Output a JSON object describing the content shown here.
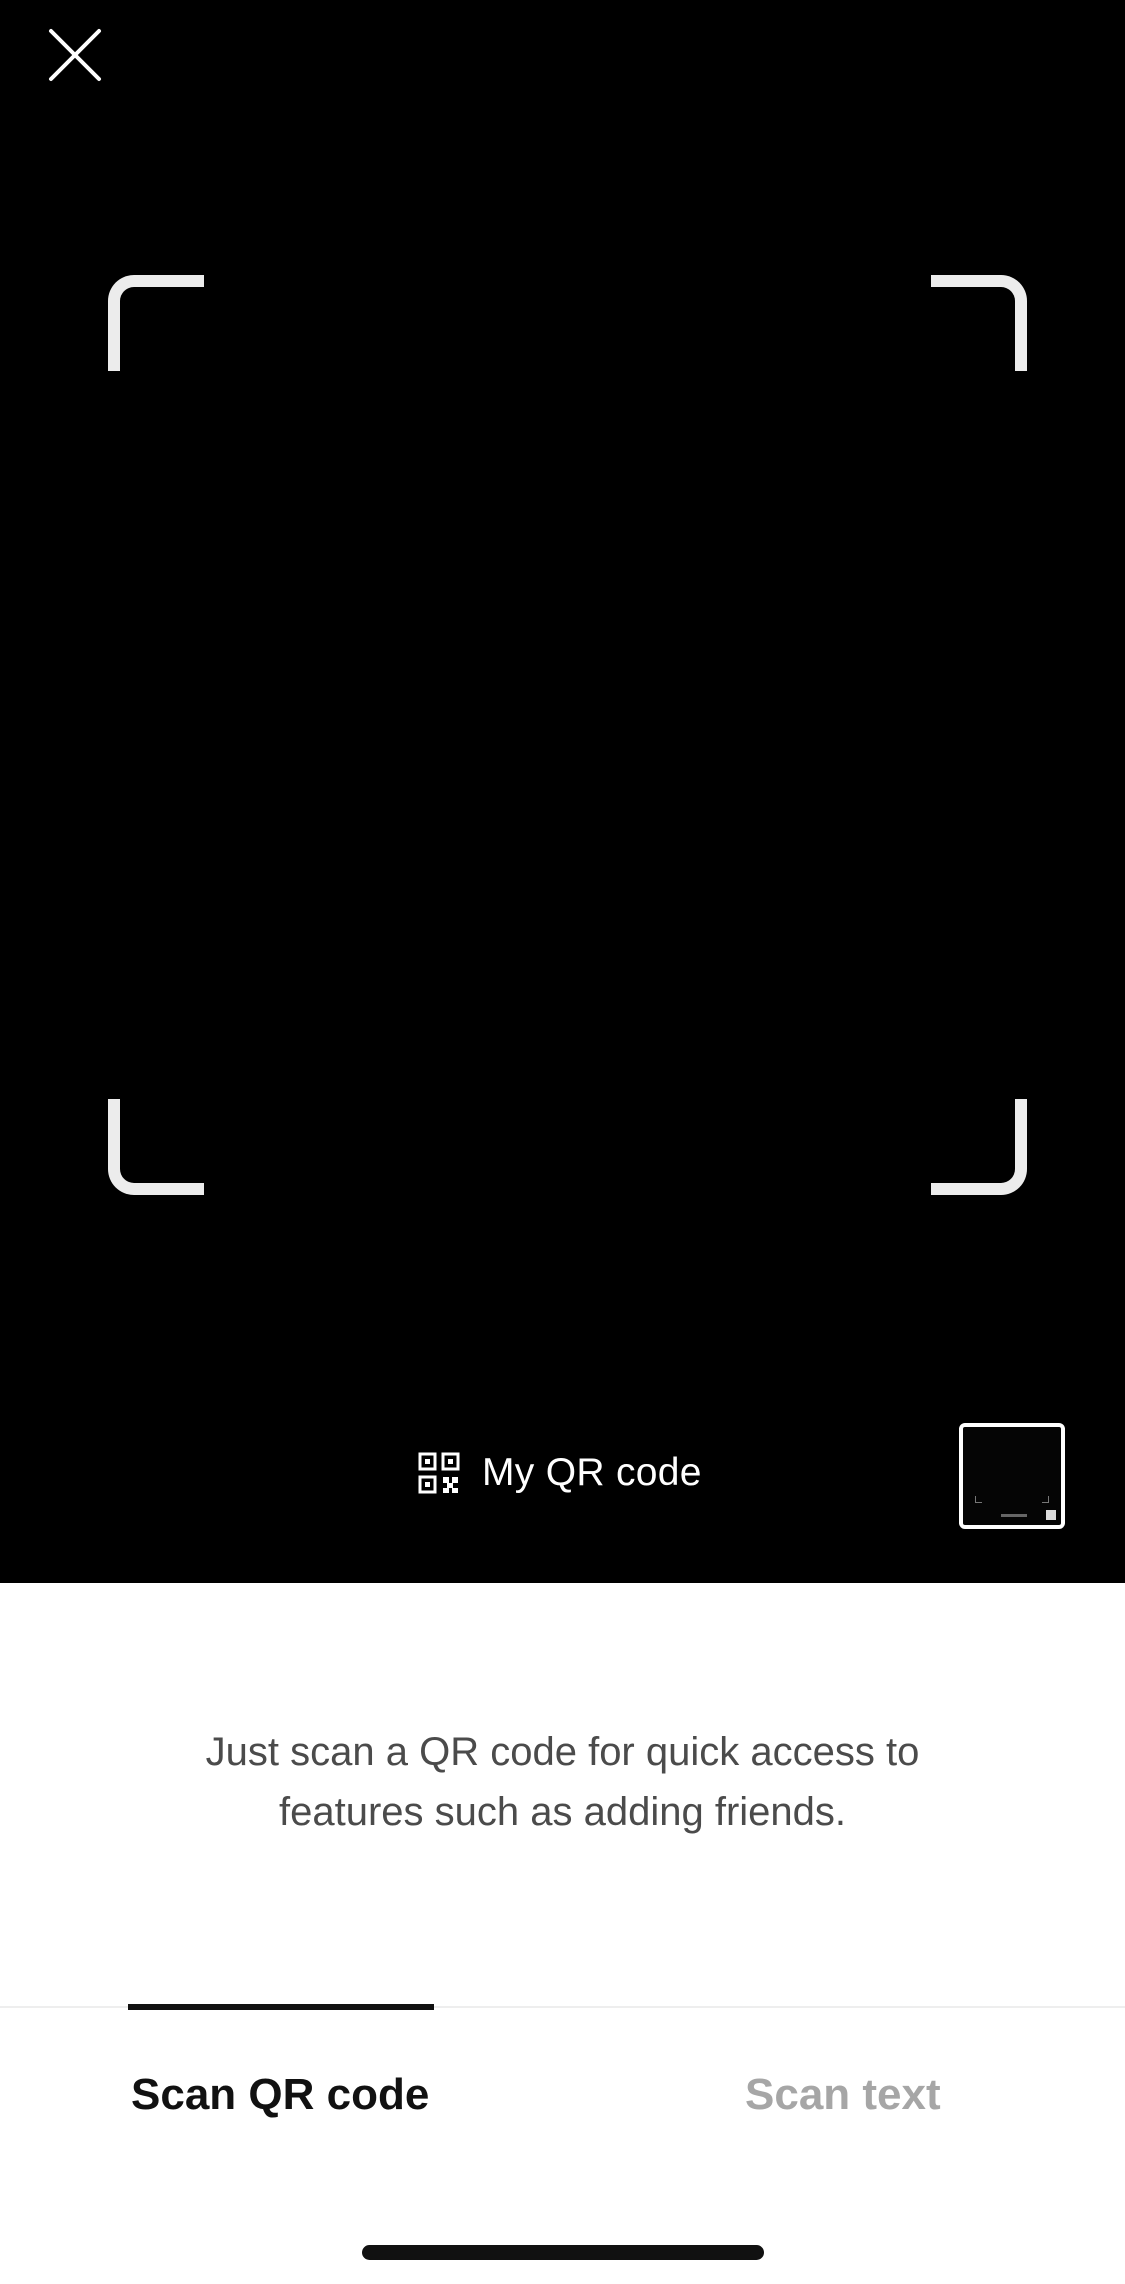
{
  "camera": {
    "close_icon": "close-icon",
    "my_qr_icon": "qr-code-icon",
    "my_qr_label": "My QR code",
    "thumbnail": "recent-photo-thumbnail"
  },
  "instruction": {
    "line1": "Just scan a QR code for quick access to",
    "line2": "features such as adding friends."
  },
  "tabs": [
    {
      "label": "Scan QR code",
      "active": true
    },
    {
      "label": "Scan text",
      "active": false
    }
  ],
  "colors": {
    "camera_background": "#000000",
    "active_tab": "#111111",
    "inactive_tab": "#a6a6a6",
    "instruction_text": "#4b4b4b"
  }
}
